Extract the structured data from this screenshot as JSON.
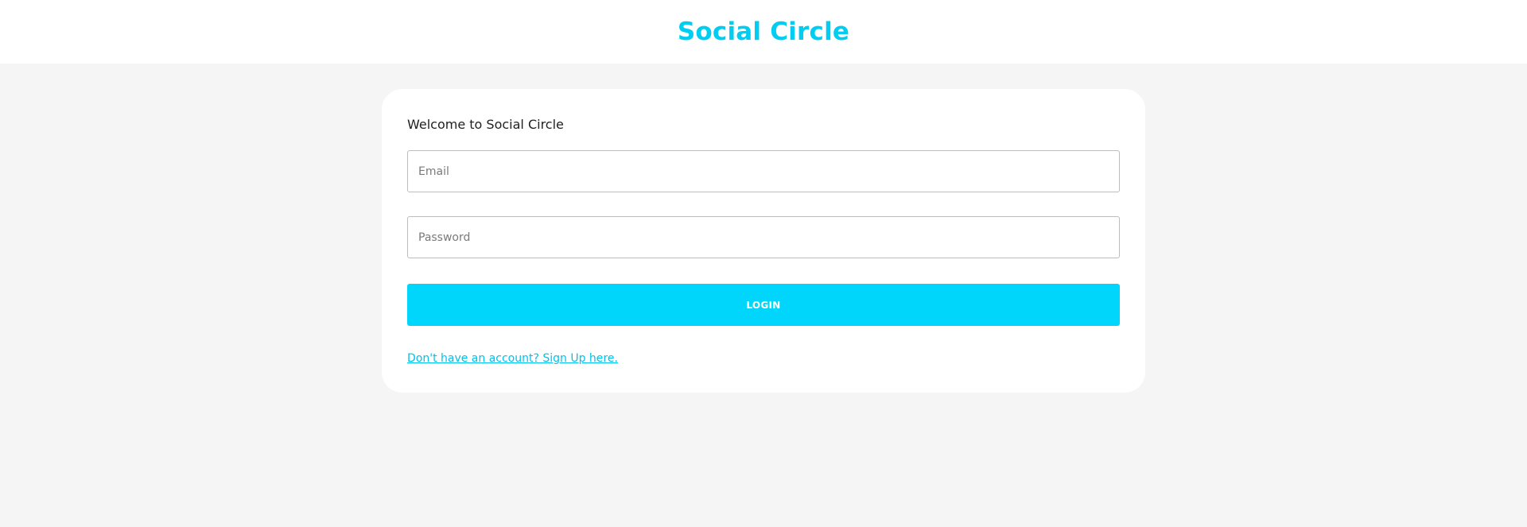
{
  "header": {
    "title": "Social Circle"
  },
  "login_card": {
    "heading": "Welcome to Social Circle",
    "email": {
      "placeholder": "Email",
      "value": ""
    },
    "password": {
      "placeholder": "Password",
      "value": ""
    },
    "login_button_label": "LOGIN",
    "signup_link_text": "Don't have an account? Sign Up here."
  },
  "colors": {
    "brand": "#00cdf2",
    "button": "#00d5fb",
    "link": "#00c2eb",
    "page_background": "#f5f5f5",
    "card_background": "#ffffff"
  }
}
